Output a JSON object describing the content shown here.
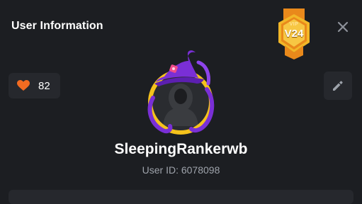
{
  "header": {
    "title": "User Information",
    "close_icon": "close-icon"
  },
  "vip": {
    "top_label": "VIP",
    "level": "V24",
    "colors": {
      "gold": "#f2b728",
      "orange": "#e9891b"
    }
  },
  "profile": {
    "likes_icon": "heart-icon",
    "likes_count": "82",
    "edit_icon": "pencil-icon",
    "username": "SleepingRankerwb",
    "user_id_text": "User ID: 6078098"
  },
  "colors": {
    "background": "#1c1e22",
    "panel": "#26282d",
    "heart": "#f26b21",
    "muted_text": "#9ea3ab",
    "avatar_ring": "#f5c21c",
    "hat": "#7a2fd6"
  }
}
